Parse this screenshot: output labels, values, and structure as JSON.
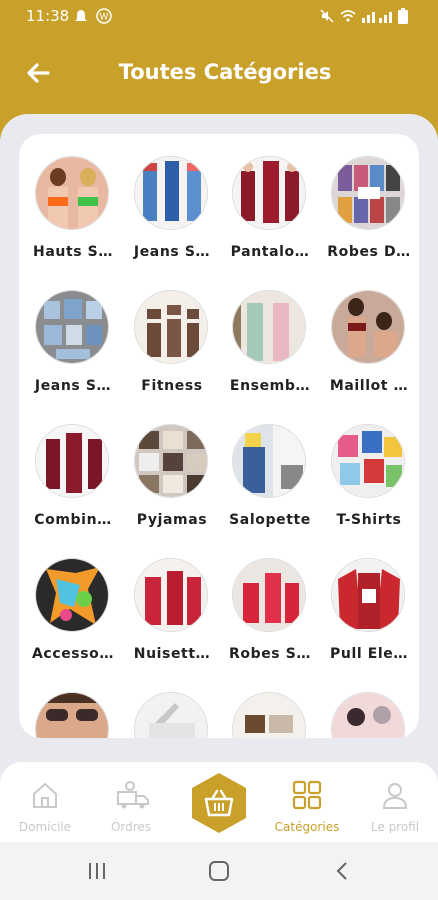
{
  "status_bar": {
    "time": "11:38"
  },
  "header": {
    "title": "Toutes Catégories"
  },
  "categories": [
    {
      "label": "Hauts S…"
    },
    {
      "label": "Jeans S…"
    },
    {
      "label": "Pantalo…"
    },
    {
      "label": "Robes D…"
    },
    {
      "label": "Jeans S…"
    },
    {
      "label": "Fitness"
    },
    {
      "label": "Ensemb…"
    },
    {
      "label": "Maillot …"
    },
    {
      "label": "Combin…"
    },
    {
      "label": "Pyjamas"
    },
    {
      "label": "Salopette"
    },
    {
      "label": "T-Shirts"
    },
    {
      "label": "Accesso…"
    },
    {
      "label": "Nuisett…"
    },
    {
      "label": "Robes S…"
    },
    {
      "label": "Pull Ele…"
    }
  ],
  "bottom_nav": {
    "home": "Domicile",
    "orders": "Ordres",
    "categories": "Catégories",
    "profile": "Le profil"
  },
  "colors": {
    "accent": "#c8a02a",
    "inactive": "#c9c9c9",
    "panel": "#ffffff",
    "background": "#ebecf2"
  }
}
